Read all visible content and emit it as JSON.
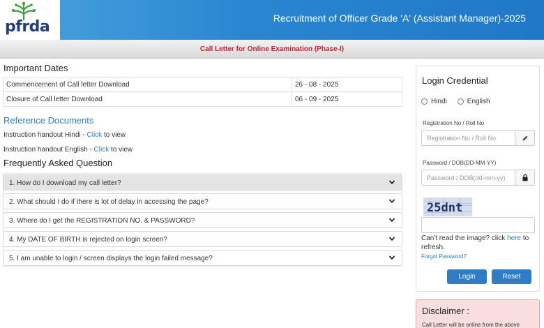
{
  "header": {
    "logo_text": "pfrda",
    "title": "Recruitment of Officer Grade 'A' (Assistant Manager)-2025"
  },
  "subheader": {
    "title": "Call Letter for Online Examination (Phase-I)"
  },
  "important_dates": {
    "title": "Important Dates",
    "rows": [
      {
        "label": "Commencement of Call letter Download",
        "value": "26 - 08 - 2025"
      },
      {
        "label": "Closure of Call letter Download",
        "value": "06 - 09 - 2025"
      }
    ]
  },
  "reference": {
    "title": "Reference Documents",
    "items": [
      {
        "prefix": "Instruction handout Hindi - ",
        "link": "Click",
        "suffix": " to view"
      },
      {
        "prefix": "Instruction handout English - ",
        "link": "Click",
        "suffix": " to view"
      }
    ]
  },
  "faq": {
    "title": "Frequently Asked Question",
    "items": [
      "1. How do I download my call letter?",
      "2. What should I do if there is lot of delay in accessing the page?",
      "3. Where do I get the REGISTRATION NO. & PASSWORD?",
      "4. My DATE OF BIRTH is rejected on login screen?",
      "5. I am unable to login / screen displays the login failed message?"
    ]
  },
  "login": {
    "title": "Login Credential",
    "language_options": [
      "Hindi",
      "English"
    ],
    "reg_label": "Registration No / Roll No",
    "reg_placeholder": "Registration No / Roll No",
    "pwd_label": "Password / DOB(DD-MM-YY)",
    "pwd_placeholder": "Password / DOB(dd-mm-yy)",
    "captcha_text": "25dnt",
    "captcha_help_prefix": "Can't read the image? click ",
    "captcha_help_link": "here",
    "captcha_help_suffix": " to refresh.",
    "forgot": "Forgot Password?",
    "login_button": "Login",
    "reset_button": "Reset"
  },
  "disclaimer": {
    "title": "Disclaimer :",
    "text": "Call Letter will be online from the above"
  },
  "colors": {
    "header_blue": "#2a86d1",
    "link_blue": "#2f7fc1",
    "button_blue": "#2f7dc6",
    "subheader_red": "#c0282d",
    "disclaimer_bg": "#f9dede"
  },
  "icons": {
    "logo": "pfrda-logo-icon",
    "faq_chevron": "chevron-down-icon",
    "reg_addon": "pencil-icon",
    "pwd_addon": "lock-icon"
  }
}
